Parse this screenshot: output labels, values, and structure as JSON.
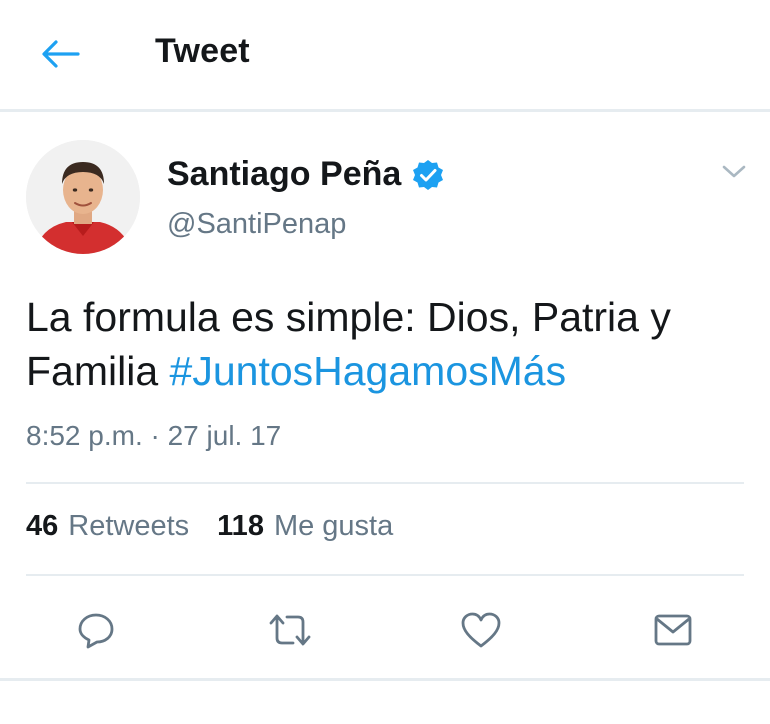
{
  "header": {
    "back_icon": "arrow-left-icon",
    "title": "Tweet"
  },
  "tweet": {
    "author_name": "Santiago Peña",
    "verified": true,
    "handle": "@SantiPenap",
    "text_plain": "La formula es simple: Dios, Patria y Familia",
    "hashtag": "#JuntosHagamosMás",
    "timestamp": "8:52 p.m. · 27 jul. 17"
  },
  "stats": {
    "retweets_count": "46",
    "retweets_label": "Retweets",
    "likes_count": "118",
    "likes_label": "Me gusta"
  },
  "actions": {
    "reply_icon": "reply-icon",
    "retweet_icon": "retweet-icon",
    "like_icon": "heart-icon",
    "dm_icon": "envelope-icon"
  },
  "colors": {
    "accent": "#1b95e0",
    "verified": "#1da1f2",
    "secondary_text": "#657786",
    "divider": "#e6ecf0",
    "avatar_shirt": "#d32f2f"
  }
}
